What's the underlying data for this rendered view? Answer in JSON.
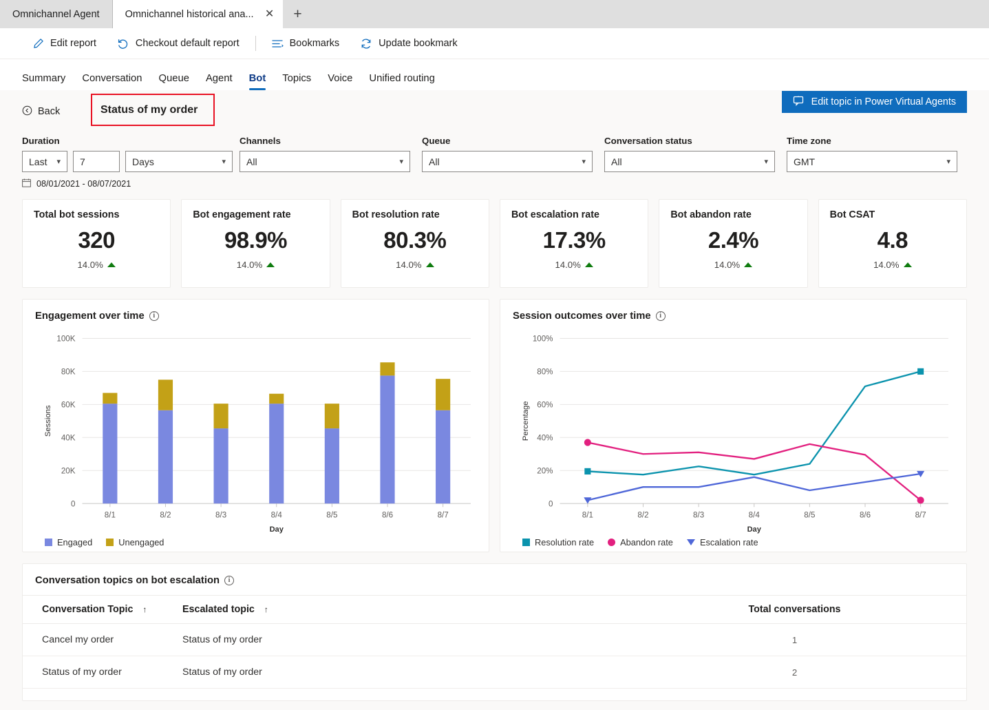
{
  "browser": {
    "tabs": [
      {
        "label": "Omnichannel Agent",
        "active": false
      },
      {
        "label": "Omnichannel historical ana...",
        "active": true
      }
    ],
    "close_glyph": "✕",
    "newtab_glyph": "+"
  },
  "commandbar": {
    "items": [
      {
        "label": "Edit report",
        "icon": "pencil-icon"
      },
      {
        "label": "Checkout default report",
        "icon": "undo-icon"
      },
      {
        "label": "Bookmarks",
        "icon": "list-icon"
      },
      {
        "label": "Update bookmark",
        "icon": "refresh-icon"
      }
    ]
  },
  "navtabs": [
    {
      "label": "Summary",
      "active": false
    },
    {
      "label": "Conversation",
      "active": false
    },
    {
      "label": "Queue",
      "active": false
    },
    {
      "label": "Agent",
      "active": false
    },
    {
      "label": "Bot",
      "active": true
    },
    {
      "label": "Topics",
      "active": false
    },
    {
      "label": "Voice",
      "active": false
    },
    {
      "label": "Unified routing",
      "active": false
    }
  ],
  "header": {
    "back_label": "Back",
    "topic_title": "Status of my order",
    "pva_button": "Edit topic in Power Virtual Agents",
    "highlight_color": "#e81123",
    "accent_color": "#0f6cbd"
  },
  "filters": {
    "duration": {
      "label": "Duration",
      "relative": "Last",
      "amount": "7",
      "unit": "Days"
    },
    "channels": {
      "label": "Channels",
      "value": "All"
    },
    "queue": {
      "label": "Queue",
      "value": "All"
    },
    "conversation_status": {
      "label": "Conversation status",
      "value": "All"
    },
    "timezone": {
      "label": "Time zone",
      "value": "GMT"
    },
    "date_range": "08/01/2021 - 08/07/2021"
  },
  "kpis": [
    {
      "title": "Total bot sessions",
      "value": "320",
      "delta": "14.0%",
      "trend": "up"
    },
    {
      "title": "Bot engagement rate",
      "value": "98.9%",
      "delta": "14.0%",
      "trend": "up"
    },
    {
      "title": "Bot resolution rate",
      "value": "80.3%",
      "delta": "14.0%",
      "trend": "up"
    },
    {
      "title": "Bot escalation rate",
      "value": "17.3%",
      "delta": "14.0%",
      "trend": "up"
    },
    {
      "title": "Bot abandon rate",
      "value": "2.4%",
      "delta": "14.0%",
      "trend": "up"
    },
    {
      "title": "Bot CSAT",
      "value": "4.8",
      "delta": "14.0%",
      "trend": "up"
    }
  ],
  "panels": {
    "engagement_title": "Engagement over time",
    "outcomes_title": "Session outcomes over time",
    "table_title": "Conversation topics on bot escalation"
  },
  "chart_data": [
    {
      "type": "bar",
      "title": "Engagement over time",
      "stacked": true,
      "xlabel": "Day",
      "ylabel": "Sessions",
      "categories": [
        "8/1",
        "8/2",
        "8/3",
        "8/4",
        "8/5",
        "8/6",
        "8/7"
      ],
      "ylim": [
        0,
        100000
      ],
      "yticks": [
        0,
        20000,
        40000,
        60000,
        80000,
        100000
      ],
      "ytick_labels": [
        "0",
        "20K",
        "40K",
        "60K",
        "80K",
        "100K"
      ],
      "grid": true,
      "legend_position": "bottom-left",
      "series": [
        {
          "name": "Engaged",
          "color": "#7a88e0",
          "values": [
            60500,
            56500,
            45500,
            60500,
            45500,
            77500,
            56500
          ]
        },
        {
          "name": "Unengaged",
          "color": "#c3a117",
          "values": [
            6500,
            18500,
            15000,
            6000,
            15000,
            8000,
            19000
          ]
        }
      ]
    },
    {
      "type": "line",
      "title": "Session outcomes over time",
      "xlabel": "Day",
      "ylabel": "Percentage",
      "categories": [
        "8/1",
        "8/2",
        "8/3",
        "8/4",
        "8/5",
        "8/6",
        "8/7"
      ],
      "ylim": [
        0,
        100
      ],
      "yticks": [
        0,
        20,
        40,
        60,
        80,
        100
      ],
      "ytick_labels": [
        "0",
        "20%",
        "40%",
        "60%",
        "80%",
        "100%"
      ],
      "grid": true,
      "legend_position": "bottom-left",
      "series": [
        {
          "name": "Resolution rate",
          "color": "#0b93ad",
          "marker": "square",
          "values": [
            19.5,
            17.5,
            22.5,
            17.5,
            24,
            71,
            80
          ]
        },
        {
          "name": "Abandon rate",
          "color": "#e2207f",
          "marker": "circle",
          "values": [
            37,
            30,
            31,
            27,
            36,
            29.5,
            2
          ]
        },
        {
          "name": "Escalation rate",
          "color": "#4f67d8",
          "marker": "triangle",
          "values": [
            2,
            10,
            10,
            16,
            8,
            13,
            18
          ]
        }
      ]
    }
  ],
  "table": {
    "columns": [
      "Conversation Topic",
      "Escalated topic",
      "Total conversations"
    ],
    "sort_glyph": "↑",
    "sortable": [
      true,
      true,
      false
    ],
    "rows": [
      {
        "topic": "Cancel my order",
        "escalated": "Status of my order",
        "total": "1"
      },
      {
        "topic": "Status of my order",
        "escalated": "Status of my order",
        "total": "2"
      }
    ]
  }
}
